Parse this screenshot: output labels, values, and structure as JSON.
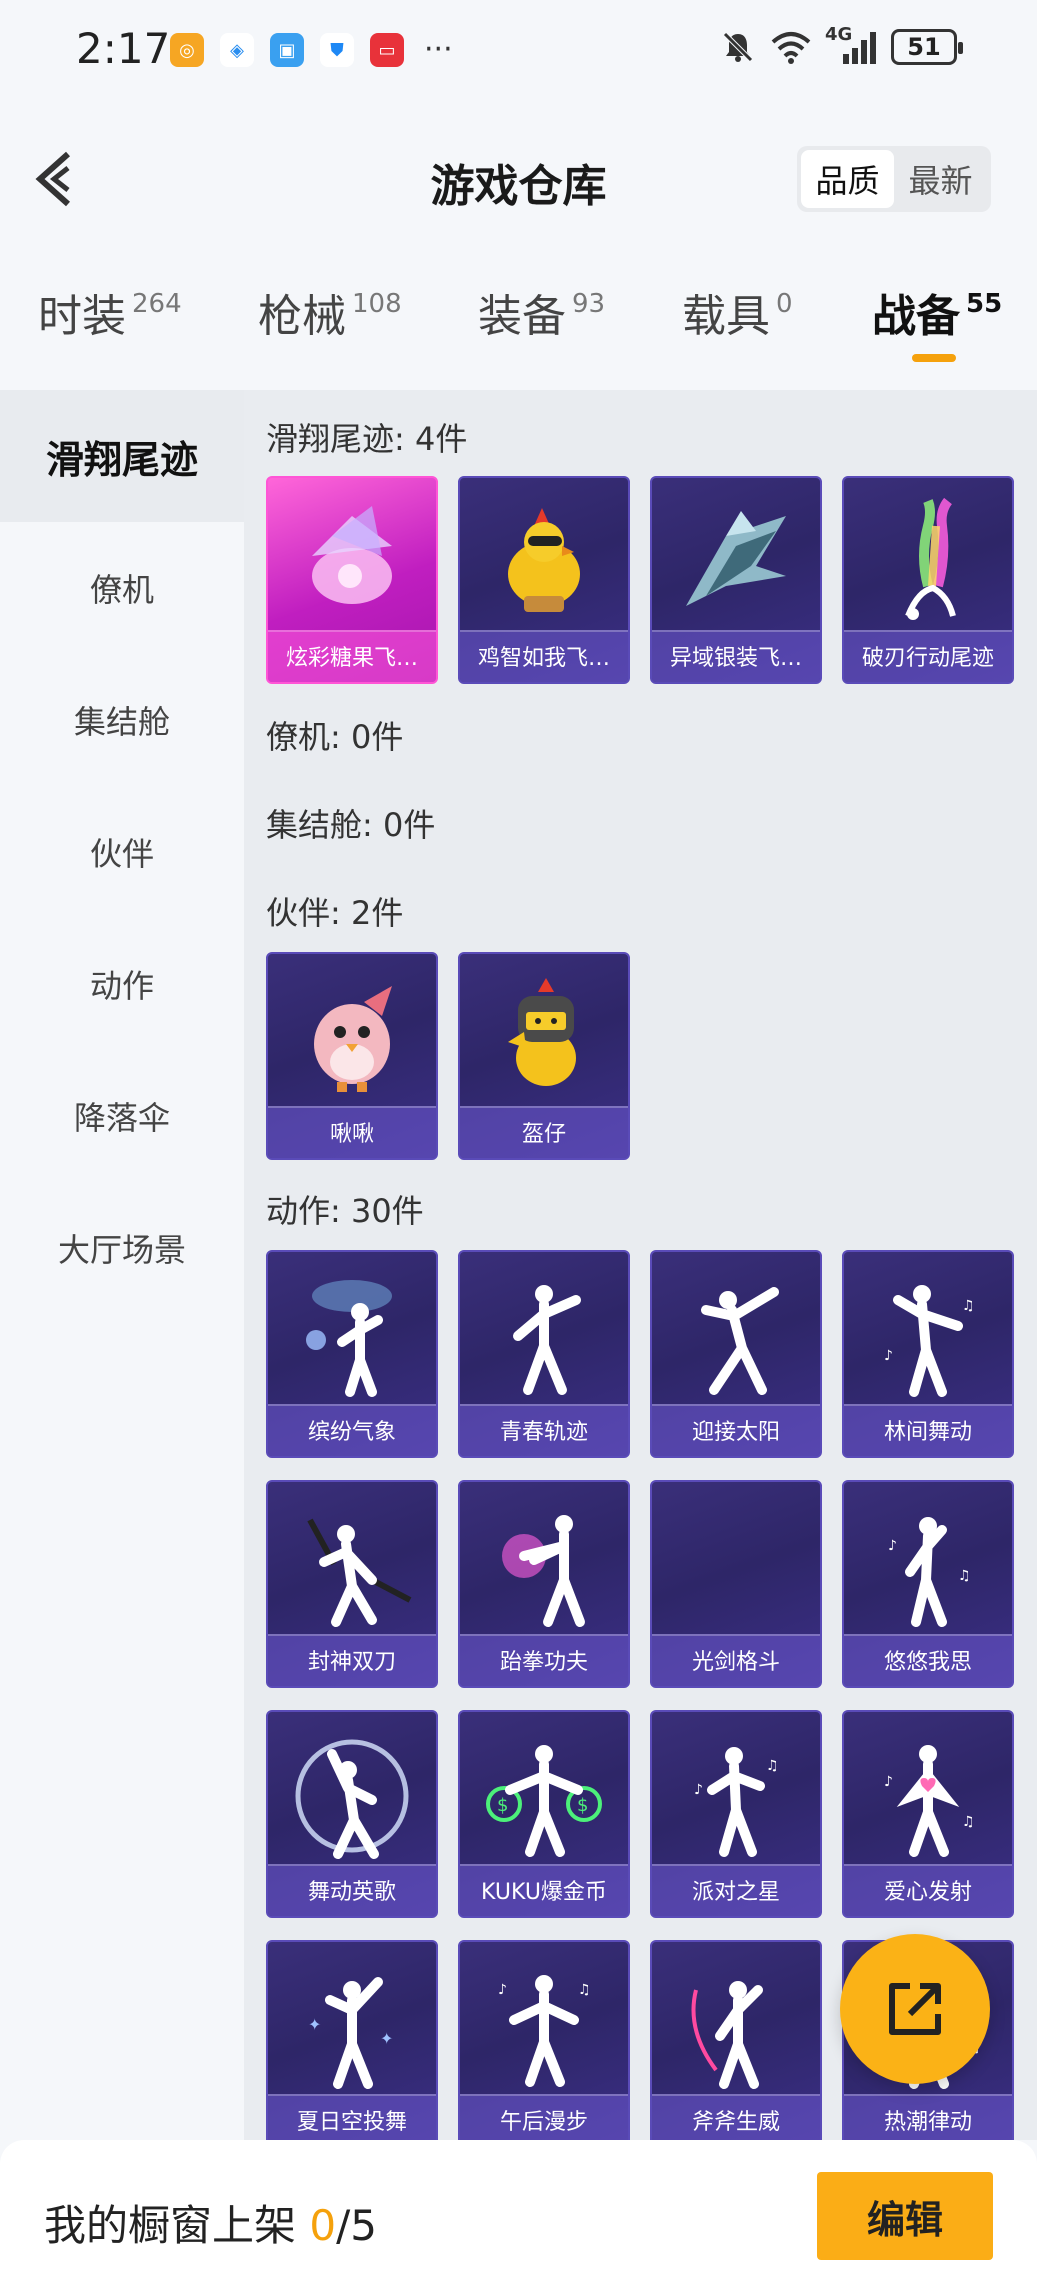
{
  "status_bar": {
    "time": "2:17",
    "network": "4G",
    "battery": "51"
  },
  "header": {
    "title": "游戏仓库",
    "sort_options": [
      {
        "label": "品质",
        "active": true
      },
      {
        "label": "最新",
        "active": false
      }
    ]
  },
  "tabs": [
    {
      "label": "时装",
      "count": "264",
      "active": false
    },
    {
      "label": "枪械",
      "count": "108",
      "active": false
    },
    {
      "label": "装备",
      "count": "93",
      "active": false
    },
    {
      "label": "载具",
      "count": "0",
      "active": false
    },
    {
      "label": "战备",
      "count": "55",
      "active": true
    }
  ],
  "sidebar": {
    "items": [
      {
        "label": "滑翔尾迹",
        "active": true
      },
      {
        "label": "僚机",
        "active": false
      },
      {
        "label": "集结舱",
        "active": false
      },
      {
        "label": "伙伴",
        "active": false
      },
      {
        "label": "动作",
        "active": false
      },
      {
        "label": "降落伞",
        "active": false
      },
      {
        "label": "大厅场景",
        "active": false
      }
    ]
  },
  "sections": {
    "glide_trail": {
      "title": "滑翔尾迹: 4件",
      "items": [
        "炫彩糖果飞…",
        "鸡智如我飞…",
        "异域银装飞…",
        "破刃行动尾迹"
      ]
    },
    "wingman": {
      "title": "僚机: 0件"
    },
    "rally_pod": {
      "title": "集结舱: 0件"
    },
    "partner": {
      "title": "伙伴: 2件",
      "items": [
        "啾啾",
        "盔仔"
      ]
    },
    "emote": {
      "title": "动作: 30件",
      "items": [
        "缤纷气象",
        "青春轨迹",
        "迎接太阳",
        "林间舞动",
        "封神双刀",
        "跆拳功夫",
        "光剑格斗",
        "悠悠我思",
        "舞动英歌",
        "KUKU爆金币",
        "派对之星",
        "爱心发射",
        "夏日空投舞",
        "午后漫步",
        "斧斧生威",
        "热潮律动"
      ]
    }
  },
  "bottom_bar": {
    "label": "我的橱窗上架 ",
    "count_current": "0",
    "count_total": "/5",
    "edit_label": "编辑"
  },
  "colors": {
    "accent": "#fbad16",
    "card_bg": "#2e2668",
    "card_highlight": "#c01ec0"
  }
}
